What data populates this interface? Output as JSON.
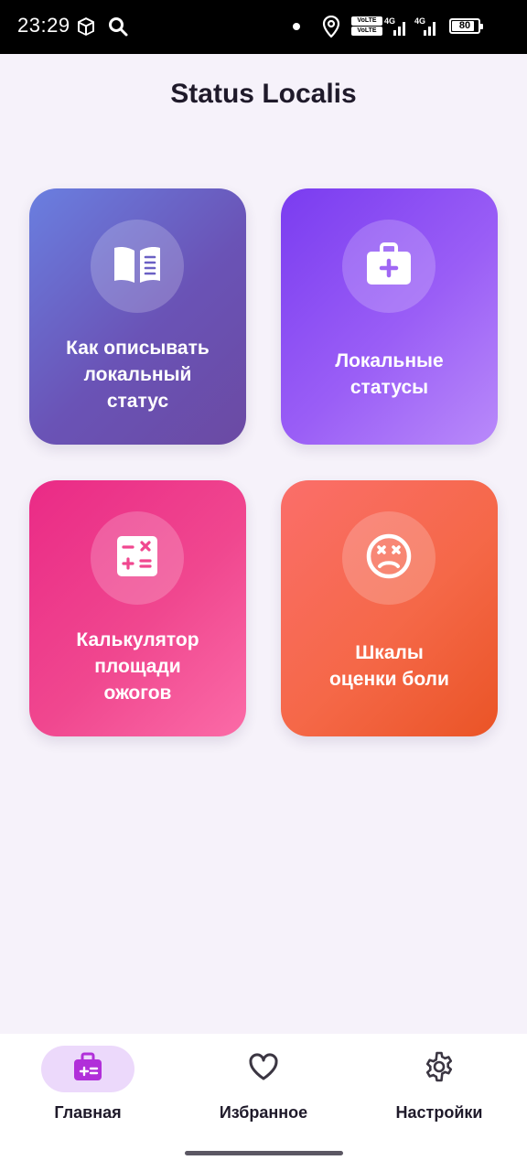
{
  "status_bar": {
    "time": "23:29",
    "volte_top": "VoLTE",
    "volte_bottom": "VoLTE",
    "network_1": "4G",
    "network_2": "4G",
    "battery": "80"
  },
  "app": {
    "title": "Status Localis"
  },
  "cards": [
    {
      "label": "Как описывать\nлокальный\nстатус",
      "icon": "open-book-icon"
    },
    {
      "label": "Локальные\nстатусы",
      "icon": "medical-kit-icon"
    },
    {
      "label": "Калькулятор\nплощади\nожогов",
      "icon": "calculator-icon"
    },
    {
      "label": "Шкалы\nоценки боли",
      "icon": "dizzy-face-icon"
    }
  ],
  "bottom_nav": {
    "items": [
      {
        "label": "Главная",
        "icon": "home-medical-icon",
        "active": true
      },
      {
        "label": "Избранное",
        "icon": "heart-icon",
        "active": false
      },
      {
        "label": "Настройки",
        "icon": "gear-icon",
        "active": false
      }
    ]
  },
  "colors": {
    "background": "#f6f2fa",
    "accent": "#b12fd9",
    "active_pill": "#ecd9fb",
    "card_1": "#6a5ac8",
    "card_2": "#9a5ef6",
    "card_3": "#f0478f",
    "card_4": "#f56848"
  }
}
